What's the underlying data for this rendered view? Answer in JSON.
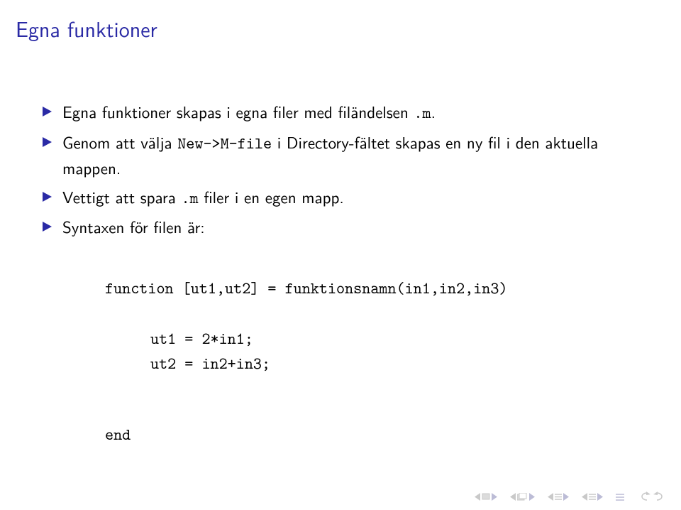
{
  "title": "Egna funktioner",
  "bullets": {
    "b1_prefix": "Egna funktioner skapas i egna filer med filändelsen ",
    "b1_code": ".m",
    "b1_suffix": ".",
    "b2_prefix": "Genom att välja ",
    "b2_code": "New->M-file",
    "b2_mid": " i Directory-fältet skapas en ny fil i den aktuella mappen.",
    "b3_prefix": "Vettigt att spara ",
    "b3_code": ".m",
    "b3_suffix": " filer i en egen mapp.",
    "b4": "Syntaxen för filen är:"
  },
  "code": {
    "line1": "function [ut1,ut2] = funktionsnamn(in1,in2,in3)",
    "line2": "ut1 = 2*in1;",
    "line3": "ut2 = in2+in3;",
    "line4": "end"
  }
}
